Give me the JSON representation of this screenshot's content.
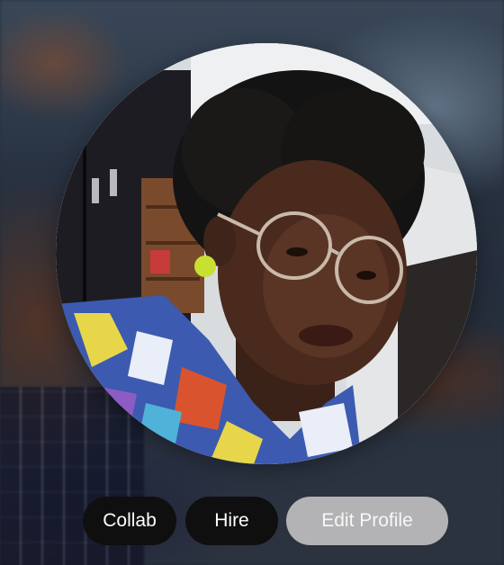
{
  "profile": {
    "cover_image": "blurred-profile-cover-photo",
    "avatar_image": "profile-photo"
  },
  "actions": {
    "collab_label": "Collab",
    "hire_label": "Hire",
    "edit_profile_label": "Edit Profile"
  },
  "colors": {
    "primary_button": "#0f0f10",
    "secondary_button": "#b3b3b5",
    "button_text": "#ffffff"
  }
}
